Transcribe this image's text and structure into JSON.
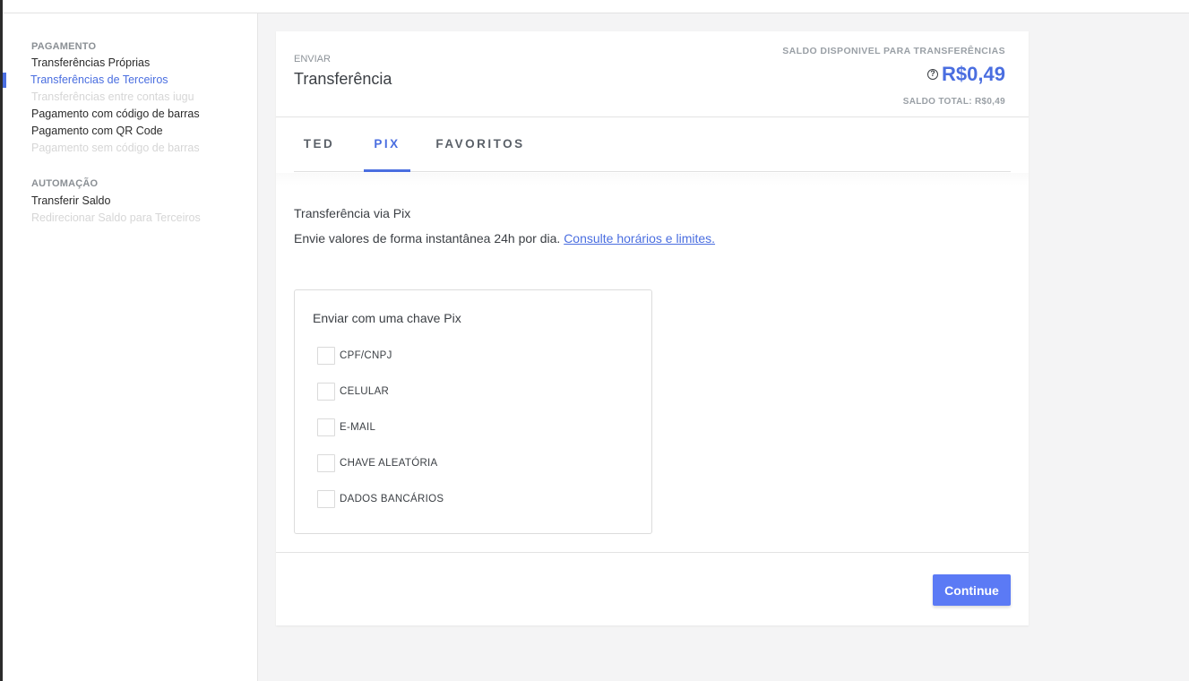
{
  "sidebar": {
    "sections": [
      {
        "title": "PAGAMENTO",
        "items": [
          {
            "label": "Transferências Próprias",
            "state": "normal"
          },
          {
            "label": "Transferências de Terceiros",
            "state": "active"
          },
          {
            "label": "Transferências entre contas iugu",
            "state": "disabled"
          },
          {
            "label": "Pagamento com código de barras",
            "state": "normal"
          },
          {
            "label": "Pagamento com QR Code",
            "state": "normal"
          },
          {
            "label": "Pagamento sem código de barras",
            "state": "disabled"
          }
        ]
      },
      {
        "title": "AUTOMAÇÃO",
        "items": [
          {
            "label": "Transferir Saldo",
            "state": "normal"
          },
          {
            "label": "Redirecionar Saldo para Terceiros",
            "state": "disabled"
          }
        ]
      }
    ]
  },
  "header": {
    "eyebrow": "ENVIAR",
    "title": "Transferência",
    "balance_label": "SALDO DISPONIVEL PARA TRANSFERÊNCIAS",
    "help_icon": "?",
    "balance_value": "R$0,49",
    "total_label": "SALDO TOTAL: R$0,49"
  },
  "tabs": [
    {
      "label": "TED",
      "active": false
    },
    {
      "label": "PIX",
      "active": true
    },
    {
      "label": "FAVORITOS",
      "active": false
    }
  ],
  "pix": {
    "title": "Transferência via Pix",
    "description": "Envie valores de forma instantânea 24h por dia.",
    "link_text": "Consulte horários e limites.",
    "key_box_title": "Enviar com uma chave Pix",
    "options": [
      {
        "label": "CPF/CNPJ",
        "checked": false
      },
      {
        "label": "CELULAR",
        "checked": false
      },
      {
        "label": "E-MAIL",
        "checked": false
      },
      {
        "label": "CHAVE ALEATÓRIA",
        "checked": false
      },
      {
        "label": "DADOS BANCÁRIOS",
        "checked": false
      }
    ]
  },
  "footer": {
    "continue_label": "Continue"
  },
  "colors": {
    "accent": "#4a6ee0",
    "button": "#5b7af5",
    "disabled_text": "#d6d6d6"
  }
}
